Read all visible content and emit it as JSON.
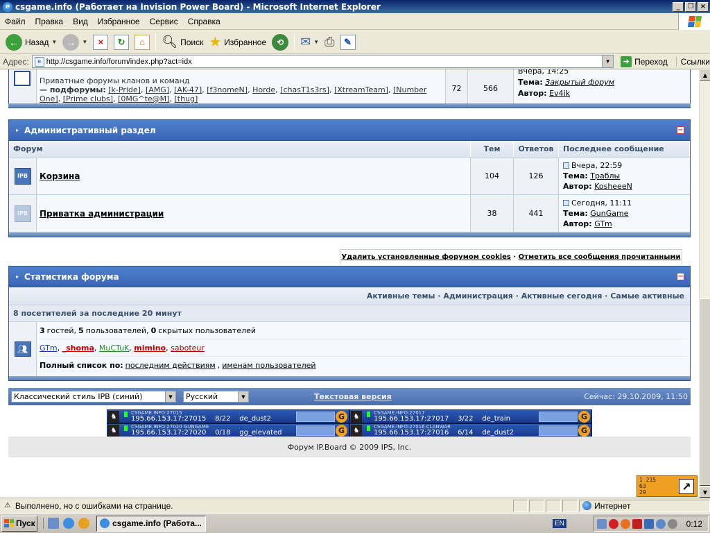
{
  "window": {
    "title": "csgame.info (Работает на Invision Power Board) - Microsoft Internet Explorer"
  },
  "menu": [
    "Файл",
    "Правка",
    "Вид",
    "Избранное",
    "Сервис",
    "Справка"
  ],
  "toolbar": {
    "back_label": "Назад",
    "search_label": "Поиск",
    "favorites_label": "Избранное"
  },
  "address": {
    "label": "Адрес:",
    "url": "http://csgame.info/forum/index.php?act=idx",
    "go_label": "Переход",
    "links_label": "Ссылки"
  },
  "top_category": {
    "description": "Приватные форумы кланов и команд",
    "subforums_label": "— подфорумы:",
    "subforums": [
      "[k-Pride]",
      "[AMG]",
      "[AK-47]",
      "[f3nomeN]",
      "Horde",
      "[chasT1s3rs]",
      "[XtreamTeam]",
      "[Number One]",
      "[Prime clubs]",
      "[0MG^te@M]",
      "[thug]"
    ],
    "topics": "72",
    "replies": "566",
    "last_date": "Вчера, 14:25",
    "last_topic_label": "Тема:",
    "last_topic": "Закрытый форум",
    "last_author_label": "Автор:",
    "last_author": "Ev4ik"
  },
  "admin_section": {
    "title": "Административный раздел",
    "columns": {
      "forum": "Форум",
      "topics": "Тем",
      "replies": "Ответов",
      "last": "Последнее сообщение"
    },
    "rows": [
      {
        "icon_text": "IPB",
        "name": "Корзина",
        "topics": "104",
        "replies": "126",
        "date": "Вчера, 22:59",
        "topic_label": "Тема:",
        "topic": "Траблы",
        "author_label": "Автор:",
        "author": "KosheeeN"
      },
      {
        "icon_text": "IPB",
        "name": "Приватка администрации",
        "topics": "38",
        "replies": "441",
        "date": "Сегодня, 11:11",
        "topic_label": "Тема:",
        "topic": "GunGame",
        "author_label": "Автор:",
        "author": "GTm"
      }
    ]
  },
  "cookie_links": {
    "delete_cookies": "Удалить установленные форумом cookies",
    "separator": "·",
    "mark_read": "Отметить все сообщения прочитанными"
  },
  "stats": {
    "title": "Статистика форума",
    "links": [
      "Активные темы",
      "Администрация",
      "Активные сегодня",
      "Самые активные"
    ],
    "links_separator": "·",
    "visitors_line": "8 посетителей за последние 20 минут",
    "guests_num": "3",
    "guests_label": "гостей,",
    "users_num": "5",
    "users_label": "пользователей,",
    "hidden_num": "0",
    "hidden_label": "скрытых пользователей",
    "online_users": [
      {
        "name": "GTm",
        "color": "#1a3aa8"
      },
      {
        "name": "_shoma",
        "color": "#cc0000"
      },
      {
        "name": "MuCTuK",
        "color": "#2a8a2a"
      },
      {
        "name": "mimino",
        "color": "#cc0000"
      },
      {
        "name": "saboteur",
        "color": "#aa0000"
      }
    ],
    "full_list_label": "Полный список по:",
    "full_list_by_activity": "последним действиям",
    "full_list_comma": ",",
    "full_list_by_name": "именам пользователей"
  },
  "bottom_bar": {
    "style_select": "Классический стиль IPB (синий)",
    "lang_select": "Русский",
    "text_version": "Текстовая версия",
    "now": "Сейчас: 29.10.2009, 11:50"
  },
  "servers": [
    {
      "name": "CSGAME.INFO:27015",
      "address": "195.66.153.17:27015",
      "players": "8/22",
      "map": "de_dust2"
    },
    {
      "name": "CSGAME.INFO:27017",
      "address": "195.66.153.17:27017",
      "players": "3/22",
      "map": "de_train"
    },
    {
      "name": "CSGAME.INFO:27020 GUNGAME",
      "address": "195.66.153.17:27020",
      "players": "0/18",
      "map": "gg_elevated"
    },
    {
      "name": "CSGAME.INFO:27016 CLANWAR",
      "address": "195.66.153.17:27016",
      "players": "6/14",
      "map": "de_dust2"
    }
  ],
  "footer": {
    "copyright": "Форум IP.Board © 2009  IPS, Inc."
  },
  "counter": {
    "line1": "1 215",
    "line2": "63",
    "line3": "29"
  },
  "statusbar": {
    "text": "Выполнено, но с ошибками на странице.",
    "zone": "Интернет"
  },
  "taskbar": {
    "start_label": "Пуск",
    "task_label": "csgame.info (Работа...",
    "lang": "EN",
    "clock": "0:12"
  }
}
